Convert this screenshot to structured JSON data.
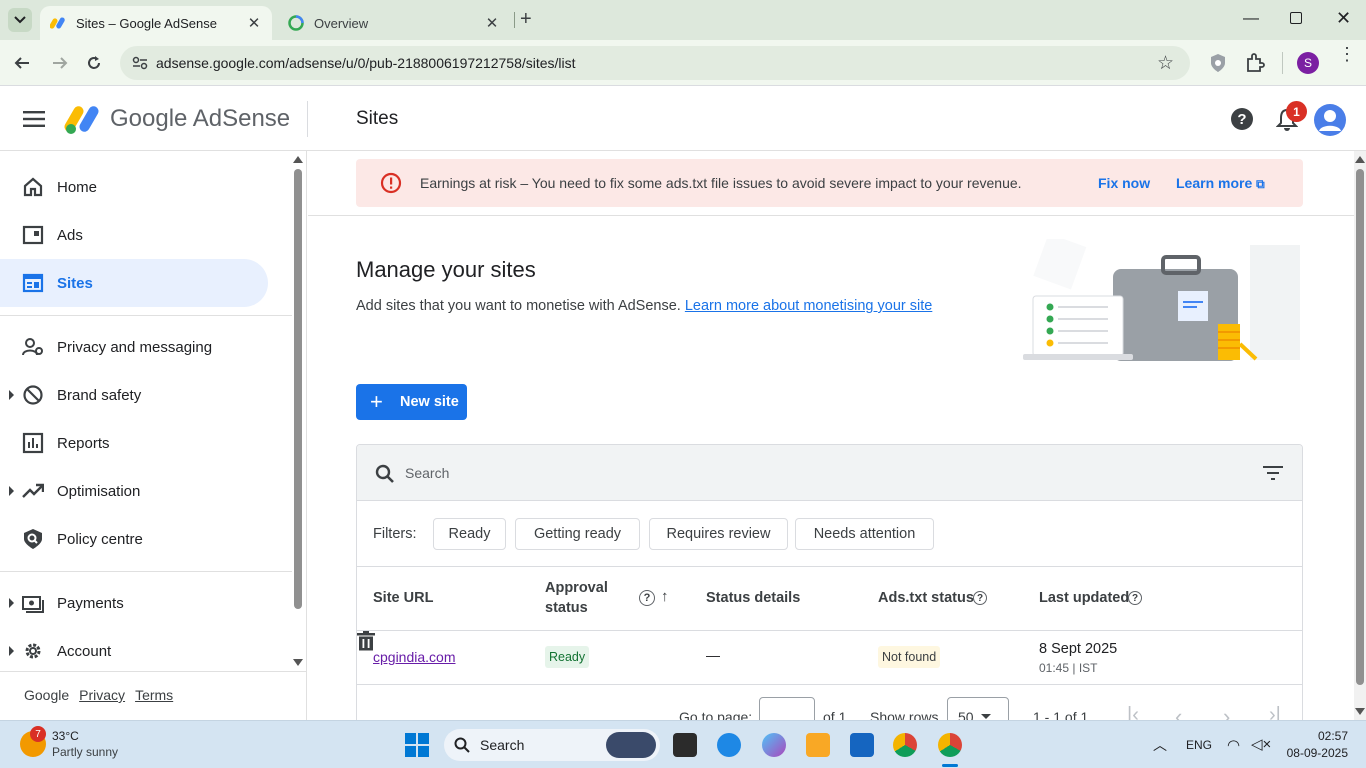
{
  "browser": {
    "tabs": [
      {
        "title": "Sites – Google AdSense",
        "active": true
      },
      {
        "title": "Overview",
        "active": false
      }
    ],
    "url": "adsense.google.com/adsense/u/0/pub-2188006197212758/sites/list",
    "profile_initial": "S"
  },
  "header": {
    "logo_text": "Google AdSense",
    "page_title": "Sites",
    "notification_count": "1"
  },
  "sidebar": {
    "items": [
      {
        "label": "Home",
        "icon": "home-icon"
      },
      {
        "label": "Ads",
        "icon": "ads-icon"
      },
      {
        "label": "Sites",
        "icon": "sites-icon",
        "active": true
      },
      {
        "label": "Privacy and messaging",
        "icon": "privacy-icon"
      },
      {
        "label": "Brand safety",
        "icon": "block-icon",
        "expandable": true
      },
      {
        "label": "Reports",
        "icon": "reports-icon"
      },
      {
        "label": "Optimisation",
        "icon": "trend-icon",
        "expandable": true
      },
      {
        "label": "Policy centre",
        "icon": "policy-icon"
      },
      {
        "label": "Payments",
        "icon": "payments-icon",
        "expandable": true
      },
      {
        "label": "Account",
        "icon": "gear-icon",
        "expandable": true
      }
    ],
    "footer": {
      "google": "Google",
      "privacy": "Privacy",
      "terms": "Terms"
    }
  },
  "alert": {
    "message": "Earnings at risk – You need to fix some ads.txt file issues to avoid severe impact to your revenue.",
    "fix_label": "Fix now",
    "learn_label": "Learn more"
  },
  "main": {
    "title": "Manage your sites",
    "subtitle": "Add sites that you want to monetise with AdSense.",
    "subtitle_link": "Learn more about monetising your site",
    "new_site_label": "New site"
  },
  "table": {
    "search_placeholder": "Search",
    "filters_label": "Filters:",
    "filters": [
      "Ready",
      "Getting ready",
      "Requires review",
      "Needs attention"
    ],
    "columns": {
      "site_url": "Site URL",
      "approval_line1": "Approval",
      "approval_line2": "status",
      "status_details": "Status details",
      "ads_txt": "Ads.txt status",
      "last_updated": "Last updated"
    },
    "rows": [
      {
        "site": "cpgindia.com",
        "approval": "Ready",
        "details": "—",
        "ads_txt": "Not found",
        "date": "8 Sept 2025",
        "time": "01:45 | IST"
      }
    ],
    "pager": {
      "goto_label": "Go to page:",
      "of_label": "of 1",
      "rows_label": "Show rows",
      "rows_value": "50",
      "range": "1 - 1 of 1"
    }
  },
  "taskbar": {
    "weather_temp": "33°C",
    "weather_desc": "Partly sunny",
    "weather_badge": "7",
    "search_label": "Search",
    "lang": "ENG",
    "time": "02:57",
    "date": "08-09-2025"
  },
  "colors": {
    "accent": "#1a73e8",
    "alert_bg": "#fce8e6",
    "alert_icon": "#d93025",
    "ready_green": "#137333"
  }
}
